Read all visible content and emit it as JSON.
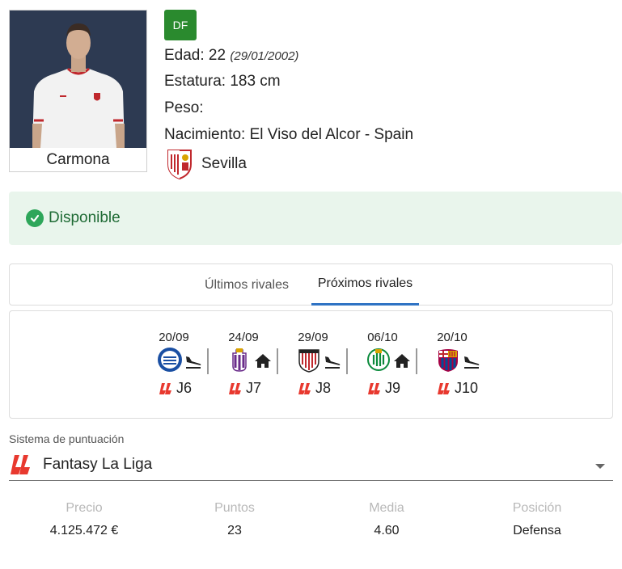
{
  "player": {
    "name": "Carmona",
    "position": "DF",
    "age_label": "Edad: 22",
    "birthdate": "(29/01/2002)",
    "height_label": "Estatura: 183 cm",
    "weight_label": "Peso:",
    "birthplace_label": "Nacimiento: El Viso del Alcor - Spain",
    "team": "Sevilla"
  },
  "status": {
    "text": "Disponible",
    "color": "#2ea65a"
  },
  "tabs": [
    {
      "label": "Últimos rivales",
      "active": false
    },
    {
      "label": "Próximos rivales",
      "active": true
    }
  ],
  "fixtures": [
    {
      "date": "20/09",
      "opponent_icon": "alaves-crest-icon",
      "venue": "away",
      "venue_icon": "plane-landing-icon",
      "matchday": "J6"
    },
    {
      "date": "24/09",
      "opponent_icon": "valladolid-crest-icon",
      "venue": "home",
      "venue_icon": "house-icon",
      "matchday": "J7"
    },
    {
      "date": "29/09",
      "opponent_icon": "athletic-crest-icon",
      "venue": "away",
      "venue_icon": "plane-landing-icon",
      "matchday": "J8"
    },
    {
      "date": "06/10",
      "opponent_icon": "betis-crest-icon",
      "venue": "home",
      "venue_icon": "house-icon",
      "matchday": "J9"
    },
    {
      "date": "20/10",
      "opponent_icon": "barcelona-crest-icon",
      "venue": "away",
      "venue_icon": "plane-landing-icon",
      "matchday": "J10"
    }
  ],
  "scoring": {
    "label": "Sistema de puntuación",
    "value": "Fantasy La Liga"
  },
  "stats": [
    {
      "label": "Precio",
      "value": "4.125.472 €"
    },
    {
      "label": "Puntos",
      "value": "23"
    },
    {
      "label": "Media",
      "value": "4.60"
    },
    {
      "label": "Posición",
      "value": "Defensa"
    }
  ],
  "colors": {
    "position_badge": "#2a8a2e",
    "status_bg": "#e9f5ec",
    "tab_underline": "#2f73c4",
    "laliga_red": "#e8392f"
  }
}
